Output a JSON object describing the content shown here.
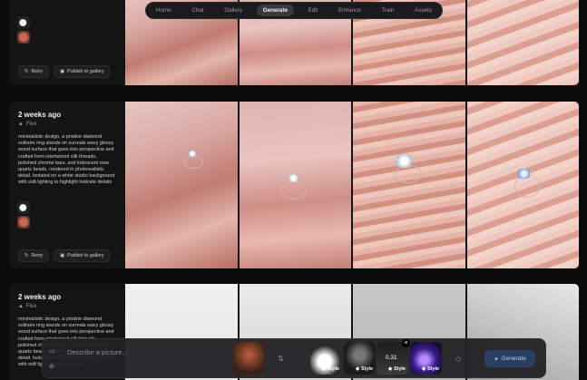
{
  "nav": {
    "tabs": [
      "Home",
      "Chat",
      "Gallery",
      "Generate",
      "Edit",
      "Enhance",
      "Train",
      "Assets"
    ],
    "active": "Generate"
  },
  "cards": [
    {
      "buttons": {
        "retry": "Retry",
        "publish": "Publish to gallery"
      }
    },
    {
      "ago": "2 weeks ago",
      "model": "Flux",
      "prompt": "minimalistic design, a pristine diamond solitaire ring stands on surreals wavy glossy wood surface that goes into perspective and crafted from intertwined silk threads, polished chrome bars, and iridescent rose quartz beads, rendered in photorealistic detail. Isolated on a white studio background with soft lighting to highlight indicate details",
      "buttons": {
        "retry": "Retry",
        "publish": "Publish to gallery"
      }
    },
    {
      "ago": "2 weeks ago",
      "model": "Flux",
      "prompt": "minimalistic design, a pristine diamond solitaire ring stands on surreals wavy glossy wood surface that goes into perspective and crafted from intertwined silk threads, polished chrome bars, and iridescent rose quartz beads, rendered in photorealistic detail. Isolated on a white studio background with soft lighting to highlight in"
    }
  ],
  "prompt_bar": {
    "placeholder": "Describe a picture...",
    "style_label": "Style",
    "style_value": "0.31",
    "generate": "Generate"
  },
  "icons": {
    "retry": "retry-icon",
    "publish": "gallery-icon",
    "model": "flux-triangle-icon",
    "image": "image-icon",
    "attach": "link-icon",
    "generate": "sparkle-icon"
  }
}
